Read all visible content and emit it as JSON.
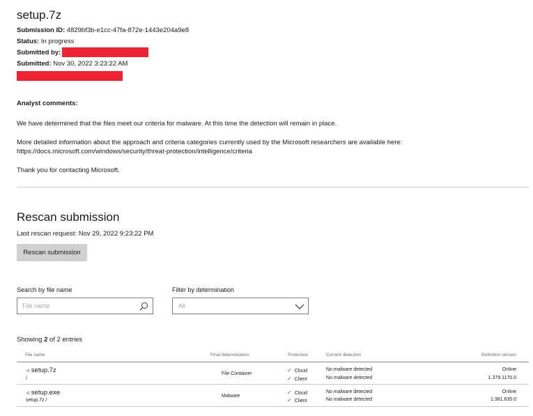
{
  "header": {
    "title": "setup.7z",
    "submission_id_label": "Submission ID:",
    "submission_id": "4829bf3b-e1cc-47fa-872e-1443e204a9e8",
    "status_label": "Status:",
    "status": "In progress",
    "submitted_by_label": "Submitted by:",
    "submitted_label": "Submitted:",
    "submitted": "Nov 30, 2022 3:23:22 AM",
    "redaction_color": "#ee2433"
  },
  "comments": {
    "heading": "Analyst comments:",
    "p1": "We have determined that the files meet our criteria for malware. At this time the detection will remain in place.",
    "p2a": "More detailed information about the approach and criteria categories currently used by the Microsoft researchers are available here:",
    "p2b": "https://docs.microsoft.com/windows/security/threat-protection/intelligence/criteria",
    "p3": "Thank you for contacting Microsoft."
  },
  "rescan": {
    "title": "Rescan submission",
    "last_request": "Last rescan request: Nov 29, 2022 9:23:22 PM",
    "button_label": "Rescan submission"
  },
  "filters": {
    "search_label": "Search by file name",
    "search_placeholder": "File name",
    "filter_label": "Filter by determination",
    "filter_value": "All"
  },
  "table": {
    "showing_prefix": "Showing ",
    "showing_count": "2",
    "showing_suffix": " of 2 entries",
    "columns": [
      "File name",
      "Final determination",
      "Protection",
      "Current detection",
      "Definition version"
    ],
    "rows": [
      {
        "name": "setup.7z",
        "path": "/",
        "determination": "File Container",
        "protection": [
          "Cloud",
          "Client"
        ],
        "detection": [
          "No malware detected",
          "No malware detected"
        ],
        "definition": [
          "Online",
          "1.379.1170.0"
        ]
      },
      {
        "name": "setup.exe",
        "path": "setup.7z /",
        "determination": "Malware",
        "protection": [
          "Cloud",
          "Client"
        ],
        "detection": [
          "No malware detected",
          "No malware detected"
        ],
        "definition": [
          "Online",
          "1.381.635.0"
        ]
      }
    ]
  }
}
